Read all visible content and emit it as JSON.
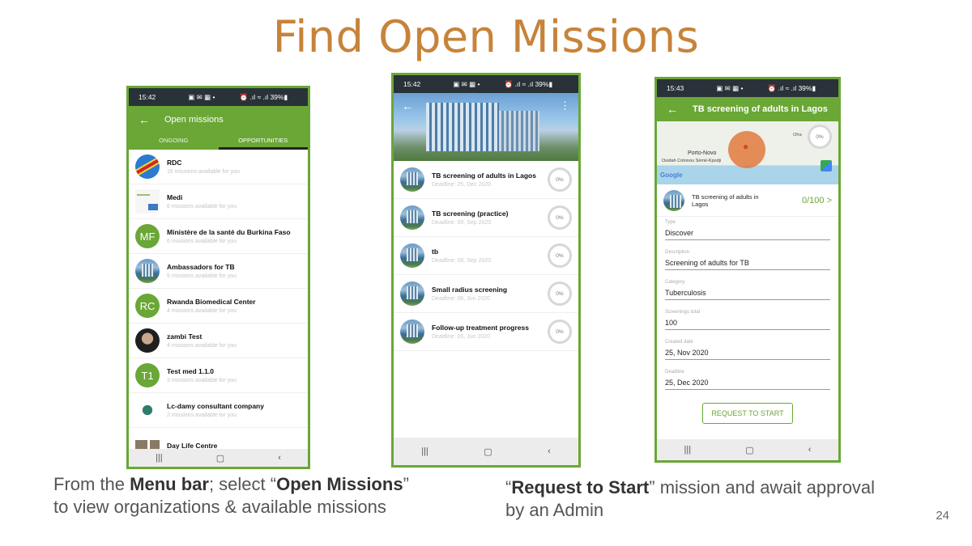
{
  "slide": {
    "title": "Find Open Missions",
    "page_number": "24",
    "caption_left": {
      "pre": "From the ",
      "b1": "Menu bar",
      "mid1": "; select “",
      "b2": "Open Missions",
      "mid2": "”",
      "line2": "to view organizations & available missions"
    },
    "caption_right": {
      "pre": "“",
      "b1": "Request to Start",
      "post": "” mission and await approval",
      "line2": "by an Admin"
    }
  },
  "status": {
    "time1": "15:42",
    "time2": "15:42",
    "time3": "15:43",
    "icons": "▣ ✉ ▦  •",
    "right": "⏰ .ıl ≈ .ıl 39%▮"
  },
  "phone1": {
    "title": "Open missions",
    "tabs": [
      "ONGOING",
      "OPPORTUNITIES"
    ],
    "orgs": [
      {
        "name": "RDC",
        "sub": "16 missions available for you"
      },
      {
        "name": "Medi",
        "sub": "6 missions available for you"
      },
      {
        "initials": "MF",
        "name": "Ministère de la santé du Burkina Faso",
        "sub": "6 missions available for you"
      },
      {
        "name": "Ambassadors for TB",
        "sub": "5 missions available for you"
      },
      {
        "initials": "RC",
        "name": "Rwanda Biomedical Center",
        "sub": "4 missions available for you"
      },
      {
        "name": "zambi Test",
        "sub": "4 missions available for you"
      },
      {
        "initials": "T1",
        "name": "Test med 1.1.0",
        "sub": "3 missions available for you"
      },
      {
        "name": "Lc-damy consultant company",
        "sub": "2 missions available for you"
      },
      {
        "name": "Day Life Centre",
        "sub": ""
      }
    ]
  },
  "phone2": {
    "missions": [
      {
        "name": "TB screening of adults in Lagos",
        "deadline": "Deadline: 25, Dec 2020",
        "progress": "0%"
      },
      {
        "name": "TB screening (practice)",
        "deadline": "Deadline: 09, Sep 2020",
        "progress": "0%"
      },
      {
        "name": "tb",
        "deadline": "Deadline: 08, Sep 2020",
        "progress": "0%"
      },
      {
        "name": "Small radius screening",
        "deadline": "Deadline: 06, Jun 2020",
        "progress": "0%"
      },
      {
        "name": "Follow-up treatment progress",
        "deadline": "Deadline: 05, Jun 2020",
        "progress": "0%"
      }
    ]
  },
  "phone3": {
    "title": "TB screening of adults in Lagos",
    "map": {
      "city": "Porto-Novo",
      "places": "Ouidah  Cotonou  Sèmè-Kpodji",
      "logo": "Google",
      "progress": "0%",
      "corner": "Ofra"
    },
    "mission_name": "TB screening of adults in Lagos",
    "count": "0/100 >",
    "fields": [
      {
        "label": "Type",
        "value": "Discover"
      },
      {
        "label": "Description",
        "value": "Screening of adults for TB"
      },
      {
        "label": "Category",
        "value": "Tuberculosis"
      },
      {
        "label": "Screenings total",
        "value": "100"
      },
      {
        "label": "Created date",
        "value": "25, Nov 2020"
      },
      {
        "label": "Deadline",
        "value": "25, Dec 2020"
      }
    ],
    "button": "REQUEST TO START"
  },
  "nav": {
    "recents": "|||",
    "home": "▢",
    "back": "‹"
  },
  "colors": {
    "accent": "#6aa736",
    "title": "#c7833a",
    "statusbar": "#283238",
    "map_marker": "#e07a3e"
  }
}
